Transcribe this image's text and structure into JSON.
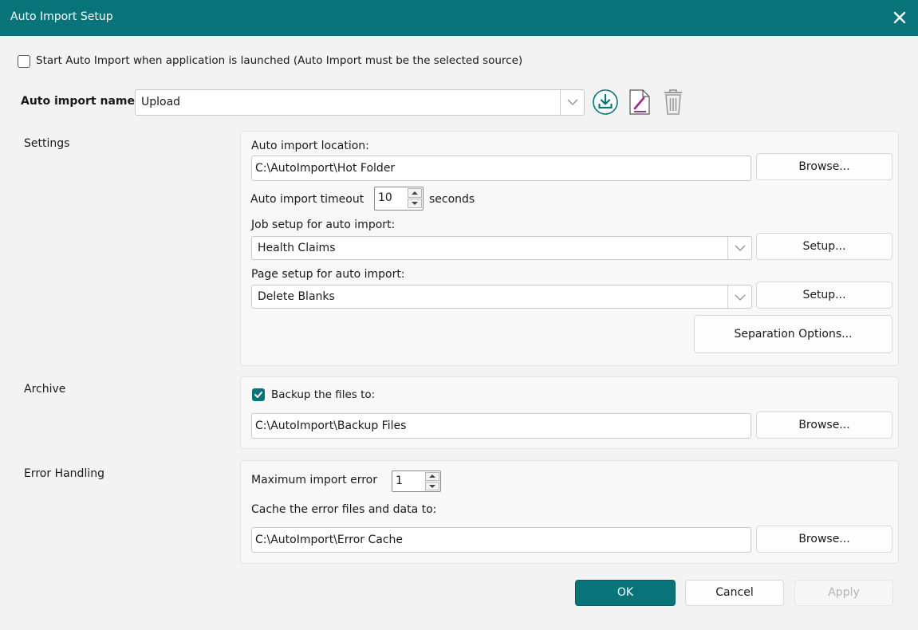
{
  "window": {
    "title": "Auto Import Setup"
  },
  "startup": {
    "checkbox_label": "Start Auto Import when application is launched (Auto Import must be the selected source)",
    "checked": false
  },
  "profile": {
    "label": "Auto import name",
    "value": "Upload"
  },
  "icons": {
    "import": "download-circle-icon",
    "edit": "edit-document-icon",
    "delete": "trash-icon"
  },
  "settings": {
    "section_label": "Settings",
    "location_label": "Auto import location:",
    "location_value": "C:\\AutoImport\\Hot Folder",
    "browse_label": "Browse...",
    "timeout_label": "Auto import timeout",
    "timeout_value": "10",
    "timeout_unit": "seconds",
    "job_label": "Job setup for auto import:",
    "job_value": "Health Claims",
    "job_setup_button": "Setup...",
    "page_label": "Page setup for auto import:",
    "page_value": "Delete Blanks",
    "page_setup_button": "Setup...",
    "separation_button": "Separation Options..."
  },
  "archive": {
    "section_label": "Archive",
    "backup_label": "Backup the files to:",
    "backup_checked": true,
    "backup_path": "C:\\AutoImport\\Backup Files",
    "browse_label": "Browse..."
  },
  "error_handling": {
    "section_label": "Error Handling",
    "max_error_label": "Maximum import error",
    "max_error_value": "1",
    "cache_label": "Cache the error files and data to:",
    "cache_path": "C:\\AutoImport\\Error Cache",
    "browse_label": "Browse..."
  },
  "footer": {
    "ok": "OK",
    "cancel": "Cancel",
    "apply": "Apply"
  },
  "colors": {
    "accent": "#087479",
    "edit_icon": "#a0328c"
  }
}
